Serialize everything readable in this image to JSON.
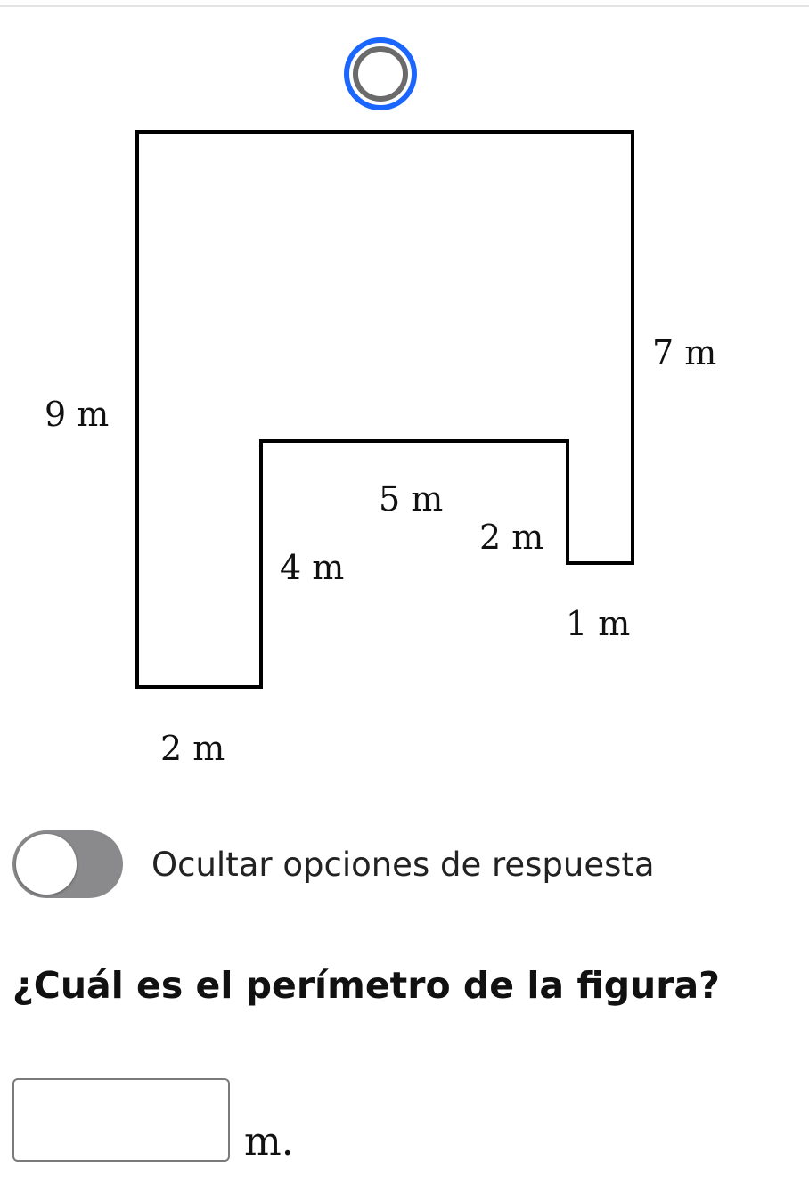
{
  "figure": {
    "labels": {
      "side_top_right": "7 m",
      "side_left": "9 m",
      "side_notch_top": "5 m",
      "side_notch_right": "2 m",
      "side_notch_left": "4 m",
      "side_right_bottom": "1 m",
      "side_bottom": "2 m"
    },
    "colors": {
      "outline": "#000000",
      "handle_ring": "#1a66ff",
      "handle_inner": "#6b6b6b"
    }
  },
  "toggle": {
    "label": "Ocultar opciones de respuesta",
    "state": "off"
  },
  "question": {
    "text": "¿Cuál es el perímetro de la figura?"
  },
  "answer": {
    "value": "",
    "unit": "m."
  }
}
